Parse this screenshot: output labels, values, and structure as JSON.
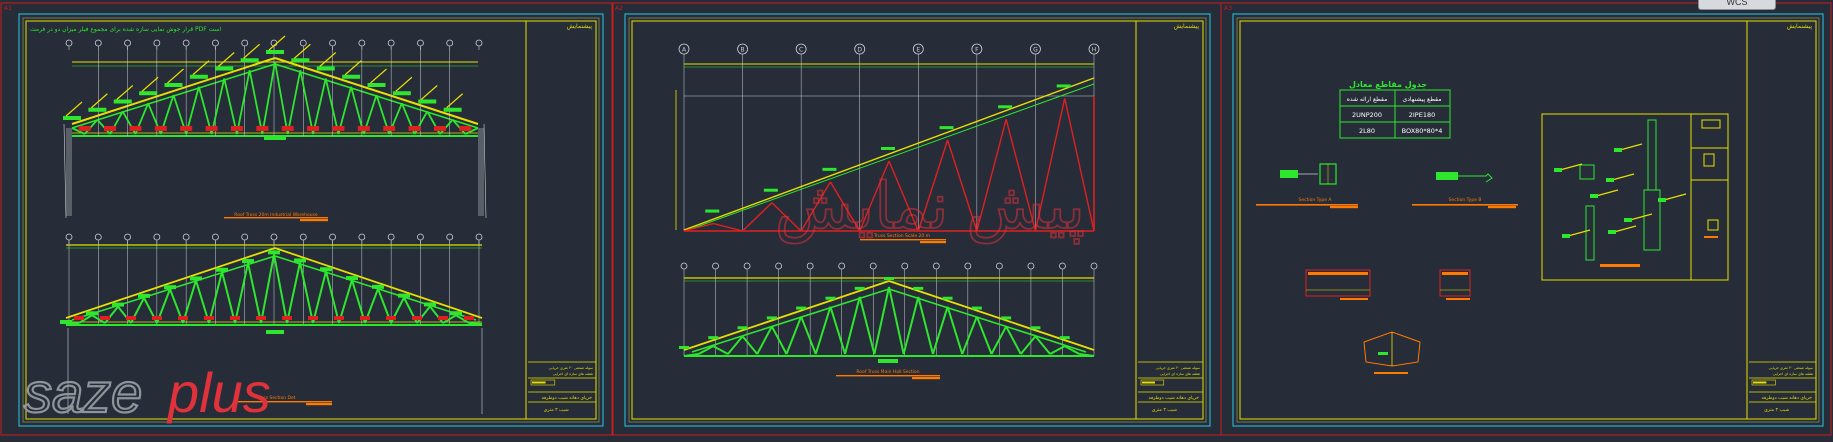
{
  "colors": {
    "background": "#262c38",
    "frame_red": "#c81e1e",
    "frame_yellow": "#e6e000",
    "frame_cyan": "#2bc7e8",
    "member_green": "#2ee62e",
    "member_yellow": "#e6e000",
    "member_red": "#e02020",
    "member_white": "#cfd3d8",
    "label_orange": "#ff7a00",
    "watermark_gray": "#8f949b",
    "watermark_red": "#e0323a"
  },
  "top_chip": {
    "label": "WCS"
  },
  "sheets": [
    {
      "tag": "A1",
      "title_note": "قرار جوش نمایی سازه شده برای مجموع فیلر میزان دو در فرمت PDF است",
      "corner_label": "پیشنمایش",
      "labels": {
        "truss_1": "Roof Truss 20m Industrial Warehouse",
        "truss_2": "Roof Truss Hardware Detail",
        "truss_3": "Truss Section Det"
      }
    },
    {
      "tag": "A2",
      "corner_label": "پیشنمایش",
      "grid_letters": [
        "A",
        "B",
        "C",
        "D",
        "E",
        "F",
        "G",
        "H"
      ],
      "labels": {
        "half_truss": "Truss Section Scale 20 m",
        "truss": "Roof Truss Main Hall Section"
      }
    },
    {
      "tag": "A3",
      "corner_label": "پیشنمایش",
      "labels": {
        "section_a": "Section Type A",
        "section_b": "Section Type B"
      }
    }
  ],
  "section_table": {
    "title": "جدول مقاطع معادل",
    "headers": [
      "مقطع پیشنهادی",
      "مقطع ارائه شده"
    ],
    "rows": [
      [
        "2IPE180",
        "2UNP200"
      ],
      [
        "BOX80*80*4",
        "2L80"
      ]
    ]
  },
  "title_block": {
    "project_lines": [
      "سوله صنعتی ۲۰ متری خرپایی",
      "نقشه های سازه ای اجرایی"
    ],
    "sheet_title": "خرپای دهانه شیب دوطرفه",
    "sheet_subtitle": "شیب ۳ متری"
  },
  "watermarks": {
    "logo_left": "saze",
    "logo_right": "plus",
    "persian": "پیش نمایش"
  }
}
